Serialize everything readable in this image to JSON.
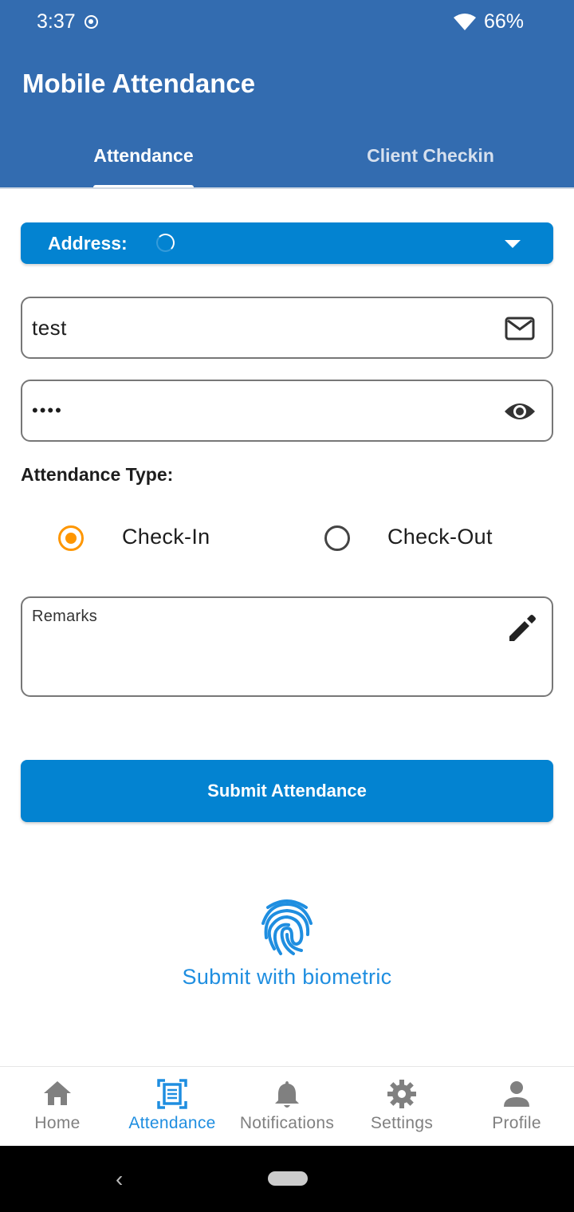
{
  "status_bar": {
    "time": "3:37",
    "battery": "66%"
  },
  "app": {
    "title": "Mobile Attendance"
  },
  "tabs": [
    {
      "label": "Attendance",
      "active": true
    },
    {
      "label": "Client Checkin",
      "active": false
    }
  ],
  "address": {
    "label": "Address:"
  },
  "email_field": {
    "value": "test",
    "icon": "mail-icon"
  },
  "password_field": {
    "value": "••••",
    "icon": "eye-icon"
  },
  "attendance_type": {
    "label": "Attendance Type:",
    "options": [
      {
        "label": "Check-In",
        "selected": true
      },
      {
        "label": "Check-Out",
        "selected": false
      }
    ]
  },
  "remarks": {
    "label": "Remarks",
    "icon": "edit-icon"
  },
  "submit": {
    "label": "Submit Attendance"
  },
  "biometric": {
    "label": "Submit with biometric",
    "icon": "fingerprint-icon"
  },
  "bottom_nav": [
    {
      "label": "Home",
      "icon": "home-icon",
      "active": false
    },
    {
      "label": "Attendance",
      "icon": "document-scan-icon",
      "active": true
    },
    {
      "label": "Notifications",
      "icon": "bell-icon",
      "active": false
    },
    {
      "label": "Settings",
      "icon": "gear-icon",
      "active": false
    },
    {
      "label": "Profile",
      "icon": "person-icon",
      "active": false
    }
  ],
  "colors": {
    "app_bar": "#336cb0",
    "primary_button": "#0383d1",
    "radio_selected": "#fe9600",
    "active_nav": "#1f8ee0"
  }
}
